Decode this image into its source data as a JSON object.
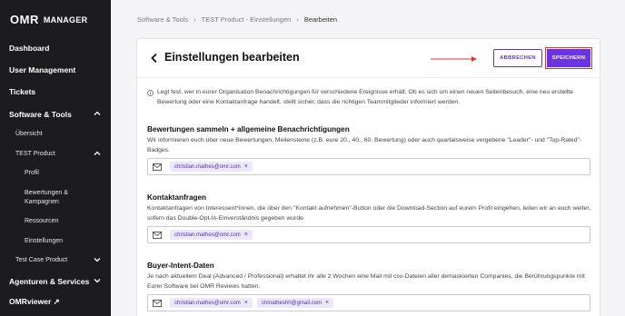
{
  "sidebar": {
    "logo_mark": "OMR",
    "logo_text": "MANAGER",
    "items": {
      "dashboard": "Dashboard",
      "user_management": "User Management",
      "tickets": "Tickets",
      "software_tools": "Software & Tools",
      "uebersicht": "Übersicht",
      "test_product": "TEST Product",
      "profil": "Profil",
      "bewertungen": "Bewertungen &",
      "kampagnen": "Kampagnen",
      "ressourcen": "Ressourcen",
      "einstellungen": "Einstellungen",
      "test_case_product": "Test Case Product",
      "agenturen": "Agenturen & Services",
      "omrviewer": "OMRviewer ↗"
    }
  },
  "breadcrumb": {
    "items": [
      "Software & Tools",
      "TEST Product - Einstellungen",
      "Bearbeiten"
    ],
    "sep": "›"
  },
  "header": {
    "title": "Einstellungen bearbeiten",
    "cancel_label": "ABBRECHEN",
    "save_label": "SPEICHERN"
  },
  "info": "Legt fest, wer in eurer Organisation Benachrichtigungen für verschiedene Ereignisse erhält. Ob es sich um einen neuen Seitenbesuch, eine neu erstellte Bewertung oder eine Kontaktanfrage handelt, stellt sicher, dass die richtigen Teammitglieder informiert werden.",
  "sections": [
    {
      "title": "Bewertungen sammeln + allgemeine Benachrichtigungen",
      "desc": "Wir informieren euch über neue Bewertungen, Meilensteine (z.B. eure 20., 40., 60. Bewertung) oder auch quartalsweise vergebene \"Leader\"- und \"Top-Rated\"-Badges.",
      "chips": [
        "christian.mathes@omr.com"
      ]
    },
    {
      "title": "Kontaktanfragen",
      "desc": "Kontaktanfragen von Interessent*innen, die über den \"Kontakt aufnehmen\"-Button oder die Download-Section auf eurem Profil eingehen, leiten wir an euch weiter, sofern das Double-Opt-In-Einverständnis gegeben wurde.",
      "chips": [
        "christian.mathes@omr.com"
      ]
    },
    {
      "title": "Buyer-Intent-Daten",
      "desc": "Je nach aktuellem Deal (Advanced / Professional) erhaltet ihr alle 2 Wochen eine Mail mit csv-Dateien aller demaskierten Companies, die Berührungspunkte mit Eurer Software bei OMR Reviews hatten.",
      "chips": [
        "christian.mathes@omr.com",
        "chmatheshh@gmail.com"
      ]
    }
  ],
  "chip_remove": "×",
  "colors": {
    "accent": "#6a35e0",
    "highlight": "#e0362e",
    "sidebar": "#1b1b20"
  }
}
